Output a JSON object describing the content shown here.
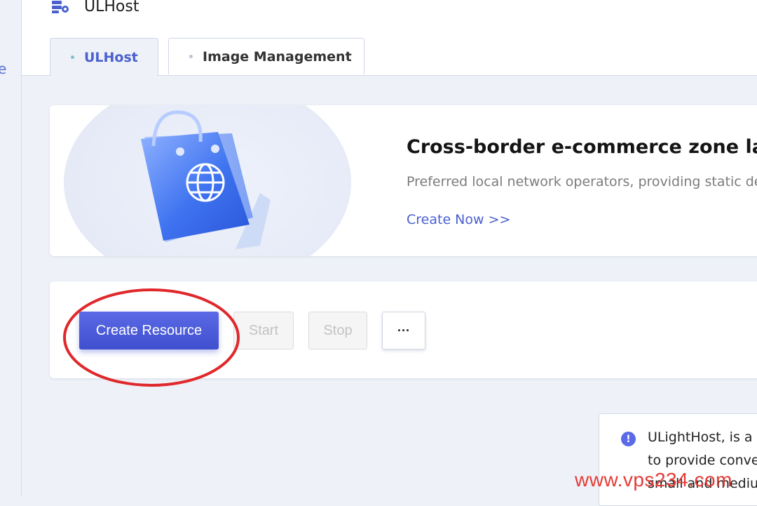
{
  "sidebar": {
    "edge_char": "e"
  },
  "header": {
    "app_icon": "server-stack-icon",
    "title": "ULHost"
  },
  "tabs": [
    {
      "label": "ULHost",
      "active": true
    },
    {
      "label": "Image Management",
      "active": false
    }
  ],
  "banner": {
    "illustration": "shopping-bag-globe-illustration",
    "title": "Cross-border e-commerce zone lands st",
    "subtitle": "Preferred local network operators, providing static ded",
    "link": "Create Now >>"
  },
  "actions": {
    "create": "Create Resource",
    "start": "Start",
    "stop": "Stop",
    "more": "···"
  },
  "notice": {
    "icon": "info-icon",
    "icon_glyph": "!",
    "lines": [
      "ULightHost, is a l",
      "to provide conver",
      "small and mediu"
    ]
  },
  "watermark": "www.vps234.com",
  "colors": {
    "accent": "#4a60cf",
    "primary_button": "#4f5ee0",
    "annotation_ring": "#e0282c",
    "watermark": "#e43b36"
  }
}
